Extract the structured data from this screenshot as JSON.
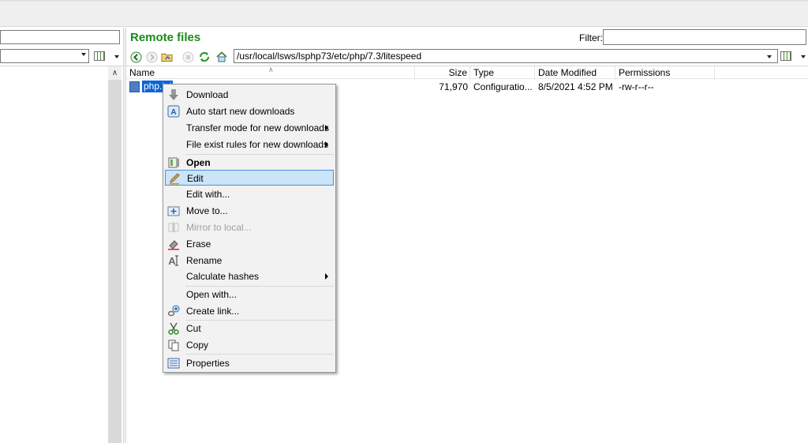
{
  "remote": {
    "title": "Remote files",
    "filter_label": "Filter:",
    "filter_value": "",
    "path": "/usr/local/lsws/lsphp73/etc/php/7.3/litespeed"
  },
  "columns": {
    "name": "Name",
    "size": "Size",
    "type": "Type",
    "date": "Date Modified",
    "perms": "Permissions"
  },
  "file": {
    "name": "php.ini",
    "name_shown": "php.ini",
    "size": "71,970",
    "type": "Configuratio...",
    "date": "8/5/2021 4:52 PM",
    "perms": "-rw-r--r--"
  },
  "menu": [
    {
      "label": "Download",
      "icon": "download-icon"
    },
    {
      "label": "Auto start new downloads",
      "icon": "auto-start-icon"
    },
    {
      "label": "Transfer mode for new downloads",
      "submenu": true
    },
    {
      "label": "File exist rules for new downloads",
      "submenu": true
    },
    {
      "label": "Open",
      "icon": "open-icon",
      "bold": true
    },
    {
      "label": "Edit",
      "icon": "edit-icon",
      "highlighted": true
    },
    {
      "label": "Edit with..."
    },
    {
      "label": "Move to...",
      "icon": "move-icon"
    },
    {
      "label": "Mirror to local...",
      "icon": "mirror-icon",
      "disabled": true
    },
    {
      "label": "Erase",
      "icon": "erase-icon"
    },
    {
      "label": "Rename",
      "icon": "rename-icon"
    },
    {
      "label": "Calculate hashes",
      "submenu": true
    },
    {
      "label": "Open with..."
    },
    {
      "label": "Create link...",
      "icon": "create-link-icon"
    },
    {
      "label": "Cut",
      "icon": "cut-icon"
    },
    {
      "label": "Copy",
      "icon": "copy-icon"
    },
    {
      "label": "Properties",
      "icon": "properties-icon"
    }
  ],
  "colors": {
    "title_green": "#1a8a1a",
    "selection_blue": "#0a64d6",
    "highlight_bg": "#cce4f7"
  }
}
